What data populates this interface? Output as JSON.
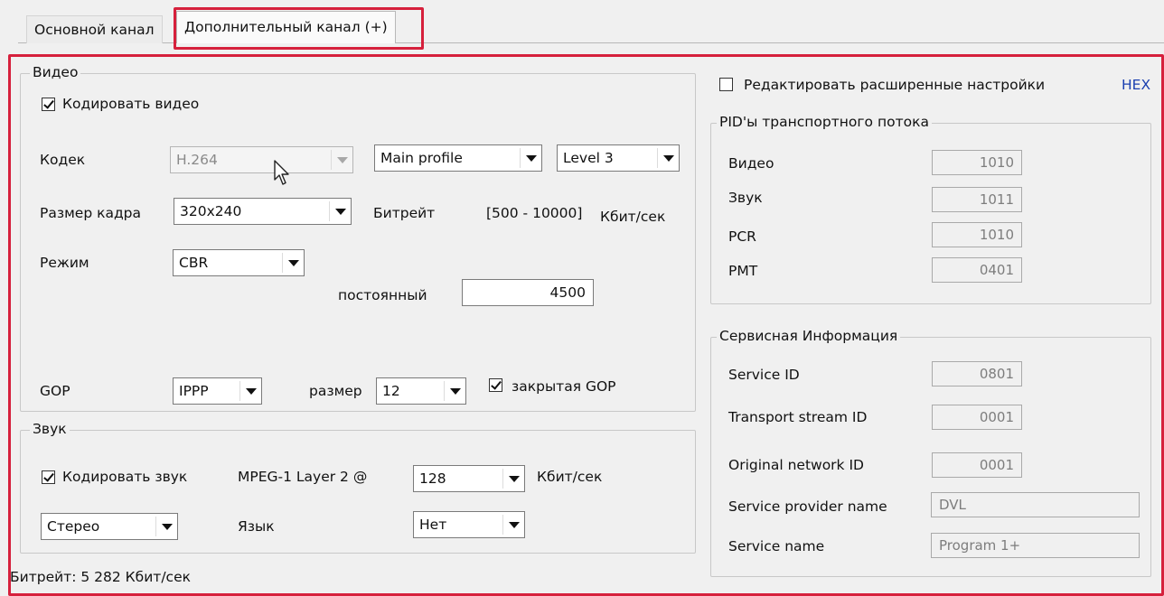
{
  "tabs": {
    "main": "Основной канал",
    "extra": "Дополнительный канал (+)"
  },
  "video": {
    "title": "Видео",
    "encode_label": "Кодировать видео",
    "codec_label": "Кодек",
    "codec_value": "H.264",
    "profile_value": "Main profile",
    "level_value": "Level 3",
    "frame_size_label": "Размер кадра",
    "frame_size_value": "320x240",
    "bitrate_label": "Битрейт",
    "bitrate_range": "[500 - 10000]",
    "bitrate_unit": "Кбит/сек",
    "mode_label": "Режим",
    "mode_value": "CBR",
    "constant_label": "постоянный",
    "constant_value": "4500",
    "gop_label": "GOP",
    "gop_value": "IPPP",
    "size_label": "размер",
    "size_value": "12",
    "closed_gop_label": "закрытая GOP"
  },
  "audio": {
    "title": "Звук",
    "encode_label": "Кодировать звук",
    "codec_text": "MPEG-1 Layer 2 @",
    "bitrate_value": "128",
    "bitrate_unit": "Кбит/сек",
    "channels_value": "Стерео",
    "language_label": "Язык",
    "language_value": "Нет"
  },
  "status": {
    "bitrate_text": "Битрейт: 5 282 Кбит/сек"
  },
  "advanced": {
    "edit_label": "Редактировать расширенные настройки",
    "hex_label": "HEX"
  },
  "pids": {
    "title": "PID'ы транспортного потока",
    "rows": [
      {
        "label": "Видео",
        "value": "1010"
      },
      {
        "label": "Звук",
        "value": "1011"
      },
      {
        "label": "PCR",
        "value": "1010"
      },
      {
        "label": "PMT",
        "value": "0401"
      }
    ]
  },
  "service": {
    "title": "Сервисная Информация",
    "service_id_label": "Service ID",
    "service_id_value": "0801",
    "ts_id_label": "Transport stream ID",
    "ts_id_value": "0001",
    "onid_label": "Original network ID",
    "onid_value": "0001",
    "provider_label": "Service provider name",
    "provider_value": "DVL",
    "name_label": "Service name",
    "name_value": "Program 1+"
  },
  "colors": {
    "highlight": "#d6203c",
    "hex_link": "#1a3fb0"
  }
}
